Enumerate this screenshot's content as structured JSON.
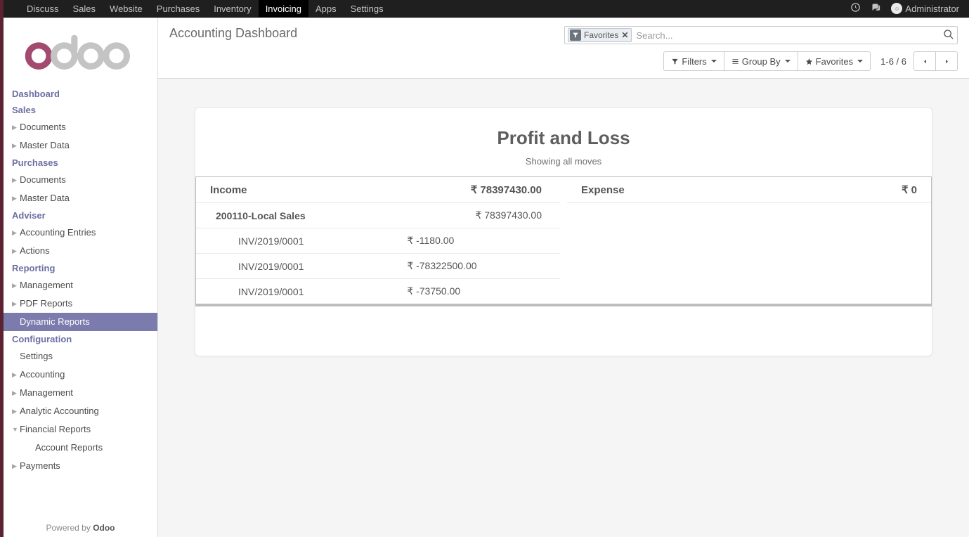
{
  "topnav": {
    "items": [
      "Discuss",
      "Sales",
      "Website",
      "Purchases",
      "Inventory",
      "Invoicing",
      "Apps",
      "Settings"
    ],
    "active": "Invoicing",
    "user": "Administrator"
  },
  "sidebar": {
    "nav": [
      {
        "type": "header",
        "label": "Dashboard"
      },
      {
        "type": "header",
        "label": "Sales"
      },
      {
        "type": "item",
        "label": "Documents",
        "level": 1,
        "caret": true
      },
      {
        "type": "item",
        "label": "Master Data",
        "level": 1,
        "caret": true
      },
      {
        "type": "header",
        "label": "Purchases"
      },
      {
        "type": "item",
        "label": "Documents",
        "level": 1,
        "caret": true
      },
      {
        "type": "item",
        "label": "Master Data",
        "level": 1,
        "caret": true
      },
      {
        "type": "header",
        "label": "Adviser"
      },
      {
        "type": "item",
        "label": "Accounting Entries",
        "level": 1,
        "caret": true
      },
      {
        "type": "item",
        "label": "Actions",
        "level": 1,
        "caret": true
      },
      {
        "type": "header",
        "label": "Reporting"
      },
      {
        "type": "item",
        "label": "Management",
        "level": 1,
        "caret": true
      },
      {
        "type": "item",
        "label": "PDF Reports",
        "level": 1,
        "caret": true
      },
      {
        "type": "item",
        "label": "Dynamic Reports",
        "level": 1,
        "caret": false,
        "active": true
      },
      {
        "type": "header",
        "label": "Configuration"
      },
      {
        "type": "item",
        "label": "Settings",
        "level": 1,
        "caret": false
      },
      {
        "type": "item",
        "label": "Accounting",
        "level": 1,
        "caret": true
      },
      {
        "type": "item",
        "label": "Management",
        "level": 1,
        "caret": true
      },
      {
        "type": "item",
        "label": "Analytic Accounting",
        "level": 1,
        "caret": true
      },
      {
        "type": "item",
        "label": "Financial Reports",
        "level": 1,
        "caret": true,
        "open": true
      },
      {
        "type": "item",
        "label": "Account Reports",
        "level": 2,
        "caret": false
      },
      {
        "type": "item",
        "label": "Payments",
        "level": 1,
        "caret": true
      }
    ],
    "powered_by_prefix": "Powered by ",
    "powered_by_brand": "Odoo"
  },
  "controlpanel": {
    "breadcrumb": "Accounting Dashboard",
    "search_tag": "Favorites",
    "search_placeholder": "Search...",
    "filters_label": "Filters",
    "groupby_label": "Group By",
    "favorites_label": "Favorites",
    "pager": "1-6 / 6"
  },
  "report": {
    "title": "Profit and Loss",
    "subtitle": "Showing all moves",
    "currency": "₹",
    "income_label": "Income",
    "income_total": "78397430.00",
    "income_group_label": "200110-Local Sales",
    "income_group_total": "78397430.00",
    "income_rows": [
      {
        "name": "INV/2019/0001",
        "amount": "-1180.00"
      },
      {
        "name": "INV/2019/0001",
        "amount": "-78322500.00"
      },
      {
        "name": "INV/2019/0001",
        "amount": "-73750.00"
      }
    ],
    "expense_label": "Expense",
    "expense_total": "0"
  }
}
